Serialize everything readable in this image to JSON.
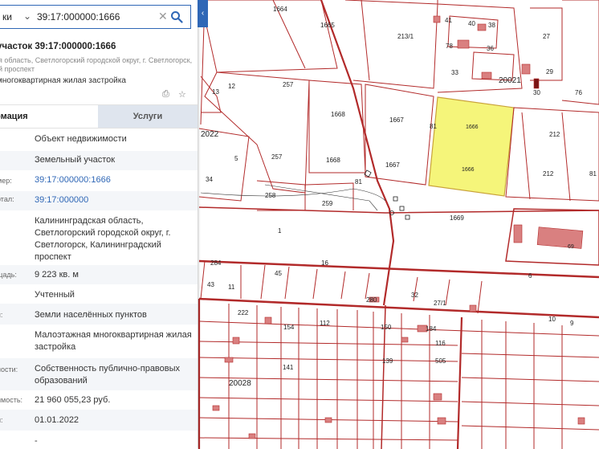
{
  "search": {
    "prefix": "ки",
    "value": "39:17:000000:1666"
  },
  "parcel": {
    "title": "участок 39:17:000000:1666",
    "address_line1": "я область, Светлогорский городской округ, г. Светлогорск,",
    "address_line2": "й проспект",
    "purpose": "многоквартирная жилая застройка"
  },
  "tabs": {
    "info": "рмация",
    "services": "Услуги"
  },
  "rows": [
    {
      "key": "",
      "value": "Объект недвижимости"
    },
    {
      "key": "",
      "value": "Земельный участок"
    },
    {
      "key": "мер:",
      "value": "39:17:000000:1666"
    },
    {
      "key": "ртал:",
      "value": "39:17:000000"
    },
    {
      "key": "",
      "value": "Калининградская область, Светлогорский городской округ, г. Светлогорск, Калининградский проспект"
    },
    {
      "key": "щадь:",
      "value": "9 223 кв. м"
    },
    {
      "key": "",
      "value": "Учтенный"
    },
    {
      "key": "я:",
      "value": "Земли населённых пунктов"
    },
    {
      "key": "",
      "value": "Малоэтажная многоквартирная жилая застройка"
    },
    {
      "key": "ности:",
      "value": "Собственность публично-правовых образований"
    },
    {
      "key": "имость:",
      "value": "21 960 055,23 руб."
    },
    {
      "key": "и:",
      "value": "01.01.2022"
    },
    {
      "key": "",
      "value": "-"
    }
  ],
  "map": {
    "highlight_color": "#f5f57a",
    "line_color": "#b22a2a",
    "labels": {
      "l1664": "1664",
      "l1665": "1665",
      "l213_1": "213/1",
      "l257a": "257",
      "l257b": "257",
      "l1668a": "1668",
      "l1668b": "1668",
      "l1667a": "1667",
      "l1667b": "1667",
      "l81a": "81",
      "l81b": "81",
      "l1666a": "1666",
      "l1666b": "1666",
      "l212a": "212",
      "l212b": "212",
      "l76": "76",
      "l81c": "81",
      "l258": "258",
      "l259": "259",
      "l1669": "1669",
      "l1": "1",
      "l16": "16",
      "l6": "6",
      "l69": "69",
      "l20021": "20021",
      "l20022": "2022",
      "l20028": "20028",
      "l284": "284",
      "l43": "43",
      "l11": "11",
      "l280": "280",
      "l32": "32",
      "l27_1": "27/1",
      "l222": "222",
      "l184": "184",
      "l505": "505",
      "l41": "41",
      "l40": "40",
      "l38": "38",
      "l78": "78",
      "l36": "36",
      "l33": "33",
      "l30": "30",
      "l29": "29",
      "l27": "27",
      "l12": "12",
      "l5": "5",
      "l34": "34",
      "l13": "13",
      "l116": "116",
      "l139": "139",
      "l112": "112",
      "l154": "154",
      "l141": "141",
      "l150": "150",
      "l10": "10",
      "l9": "9",
      "l45": "45"
    }
  }
}
